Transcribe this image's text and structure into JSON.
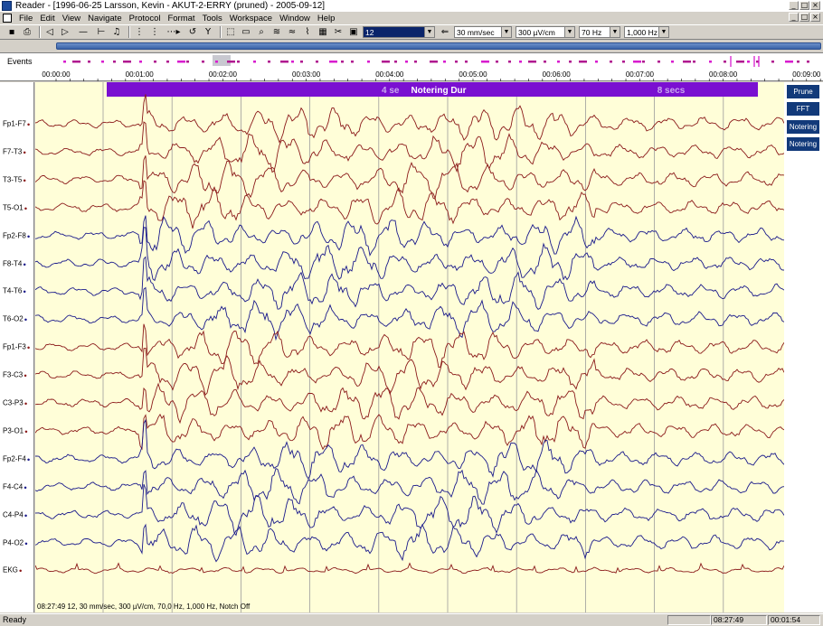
{
  "window": {
    "title": "Reader - [1996-06-25 Larsson, Kevin - AKUT-2-ERRY  (pruned) - 2005-09-12]"
  },
  "menu": {
    "items": [
      "File",
      "Edit",
      "View",
      "Navigate",
      "Protocol",
      "Format",
      "Tools",
      "Workspace",
      "Window",
      "Help"
    ]
  },
  "toolbar": {
    "montage_value": "12",
    "speed_value": "30 mm/sec",
    "sensitivity_value": "300 µV/cm",
    "hf_filter_value": "70 Hz",
    "lf_filter_value": "1,000 Hz"
  },
  "events": {
    "label": "Events"
  },
  "ruler": {
    "ticks": [
      "00:00:00",
      "00:01:00",
      "00:02:00",
      "00:03:00",
      "00:04:00",
      "00:05:00",
      "00:06:00",
      "00:07:00",
      "00:08:00",
      "00:09:00"
    ]
  },
  "annotation": {
    "left_text": "4 se",
    "center_text": "Notering Dur",
    "right_text": "8 secs"
  },
  "channels": [
    {
      "name": "Fp1-F7",
      "color": "#8b1a1a"
    },
    {
      "name": "F7-T3",
      "color": "#8b1a1a"
    },
    {
      "name": "T3-T5",
      "color": "#8b1a1a"
    },
    {
      "name": "T5-O1",
      "color": "#8b1a1a"
    },
    {
      "name": "Fp2-F8",
      "color": "#1a1a8b"
    },
    {
      "name": "F8-T4",
      "color": "#1a1a8b"
    },
    {
      "name": "T4-T6",
      "color": "#1a1a8b"
    },
    {
      "name": "T6-O2",
      "color": "#1a1a8b"
    },
    {
      "name": "Fp1-F3",
      "color": "#8b1a1a"
    },
    {
      "name": "F3-C3",
      "color": "#8b1a1a"
    },
    {
      "name": "C3-P3",
      "color": "#8b1a1a"
    },
    {
      "name": "P3-O1",
      "color": "#8b1a1a"
    },
    {
      "name": "Fp2-F4",
      "color": "#1a1a8b"
    },
    {
      "name": "F4-C4",
      "color": "#1a1a8b"
    },
    {
      "name": "C4-P4",
      "color": "#1a1a8b"
    },
    {
      "name": "P4-O2",
      "color": "#1a1a8b"
    },
    {
      "name": "EKG",
      "color": "#8b1a1a"
    }
  ],
  "side_buttons": [
    "Prune",
    "FFT",
    "Notering",
    "Notering"
  ],
  "plot_info": "08:27:49 12, 30 mm/sec, 300 µV/cm, 70,0 Hz, 1,000 Hz, Notch Off",
  "status": {
    "ready": "Ready",
    "clock": "08:27:49",
    "elapsed": "00:01:54"
  },
  "colors": {
    "plot_bg": "#fffed8",
    "annotation": "#7a0fd1",
    "event_marker": "#d81ccf",
    "red_trace": "#8b1a1a",
    "blue_trace": "#1a1a8b"
  }
}
